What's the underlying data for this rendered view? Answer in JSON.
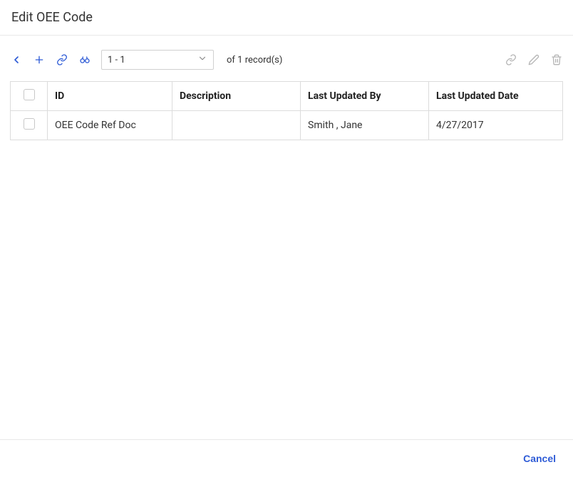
{
  "header": {
    "title": "Edit OEE Code"
  },
  "toolbar": {
    "page_range": "1 - 1",
    "record_prefix": "of",
    "record_count": "1",
    "record_suffix": "record(s)"
  },
  "table": {
    "columns": {
      "id": "ID",
      "description": "Description",
      "last_updated_by": "Last Updated By",
      "last_updated_date": "Last Updated Date"
    },
    "rows": [
      {
        "id": "OEE Code Ref Doc",
        "description": "",
        "last_updated_by": "Smith , Jane",
        "last_updated_date": "4/27/2017"
      }
    ]
  },
  "footer": {
    "cancel_label": "Cancel"
  }
}
